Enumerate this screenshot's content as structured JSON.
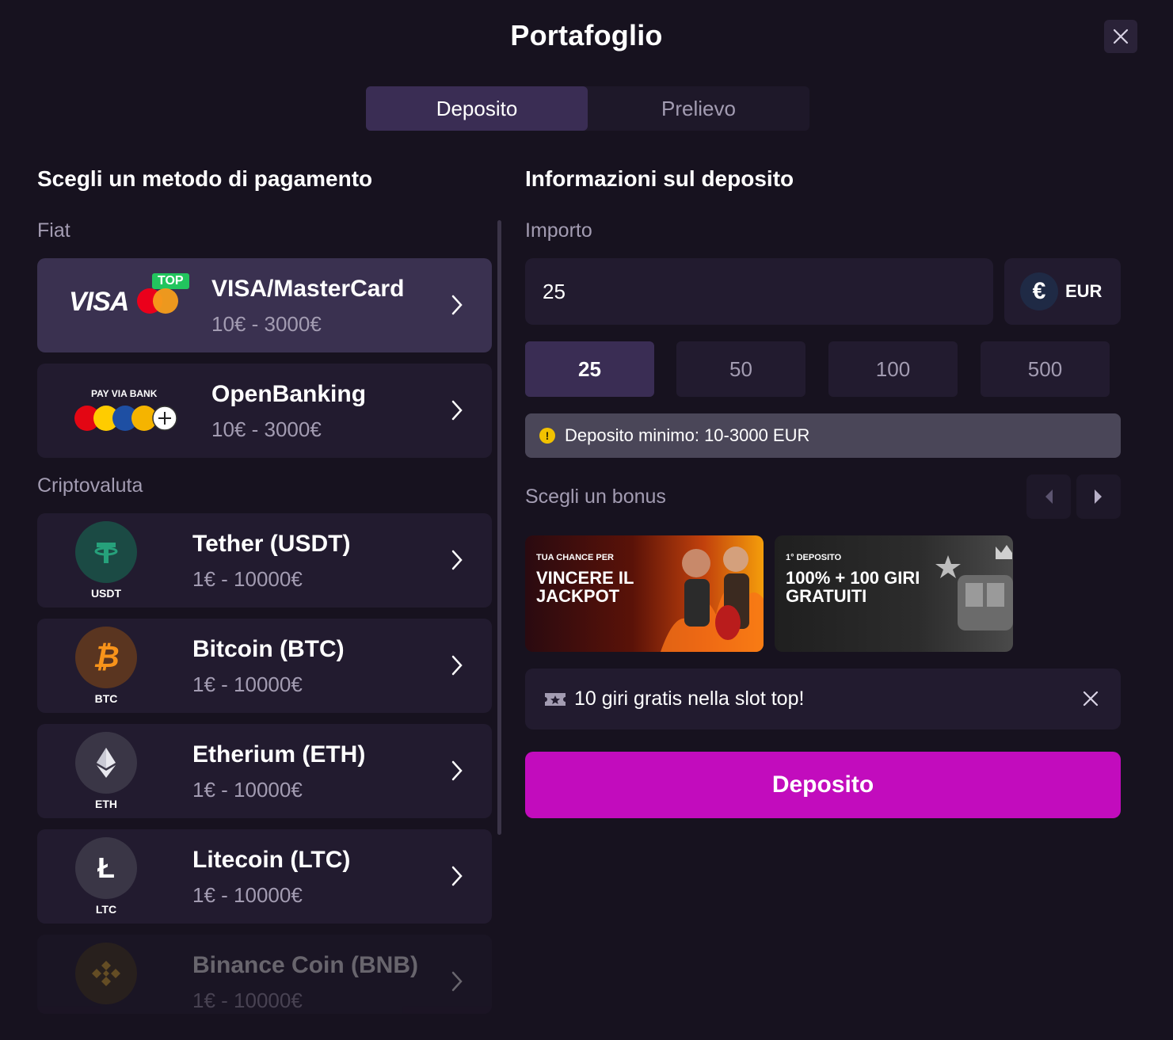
{
  "header": {
    "title": "Portafoglio"
  },
  "tabs": [
    {
      "label": "Deposito",
      "active": true
    },
    {
      "label": "Prelievo",
      "active": false
    }
  ],
  "left": {
    "title": "Scegli un metodo di pagamento",
    "fiat_label": "Fiat",
    "crypto_label": "Criptovaluta",
    "fiat_methods": [
      {
        "name": "VISA/MasterCard",
        "range": "10€ - 3000€",
        "badge": "TOP",
        "logo_text": "VISA",
        "selected": true
      },
      {
        "name": "OpenBanking",
        "range": "10€ - 3000€",
        "logo_text": "PAY VIA BANK"
      }
    ],
    "crypto_methods": [
      {
        "name": "Tether (USDT)",
        "range": "1€ - 10000€",
        "code": "USDT",
        "icon": "tether-icon",
        "color": "#26a17b"
      },
      {
        "name": "Bitcoin (BTC)",
        "range": "1€ - 10000€",
        "code": "BTC",
        "icon": "bitcoin-icon",
        "color": "#f7931a"
      },
      {
        "name": "Etherium (ETH)",
        "range": "1€ - 10000€",
        "code": "ETH",
        "icon": "ethereum-icon",
        "color": "#e8e8ee"
      },
      {
        "name": "Litecoin (LTC)",
        "range": "1€ - 10000€",
        "code": "LTC",
        "icon": "litecoin-icon",
        "color": "#ffffff"
      },
      {
        "name": "Binance Coin (BNB)",
        "range": "1€ - 10000€",
        "code": "BNB",
        "icon": "binance-icon",
        "color": "#f3ba2f"
      }
    ]
  },
  "right": {
    "title": "Informazioni sul deposito",
    "amount_label": "Importo",
    "amount_value": "25",
    "currency": {
      "symbol": "€",
      "code": "EUR"
    },
    "presets": [
      "25",
      "50",
      "100",
      "500"
    ],
    "active_preset": "25",
    "info": "Deposito minimo: 10-3000 EUR",
    "bonus_label": "Scegli un bonus",
    "bonuses": [
      {
        "small": "TUA CHANCE PER",
        "big": "VINCERE IL JACKPOT"
      },
      {
        "small": "1° DEPOSITO",
        "big": "100% + 100 GIRI GRATUITI"
      }
    ],
    "promo": "10 giri gratis nella slot top!",
    "submit": "Deposito"
  },
  "colors": {
    "accent": "#c20cbd",
    "background": "#17121f",
    "card": "#221b2f",
    "selected_card": "#3a3150",
    "muted_text": "#a39cb2"
  }
}
